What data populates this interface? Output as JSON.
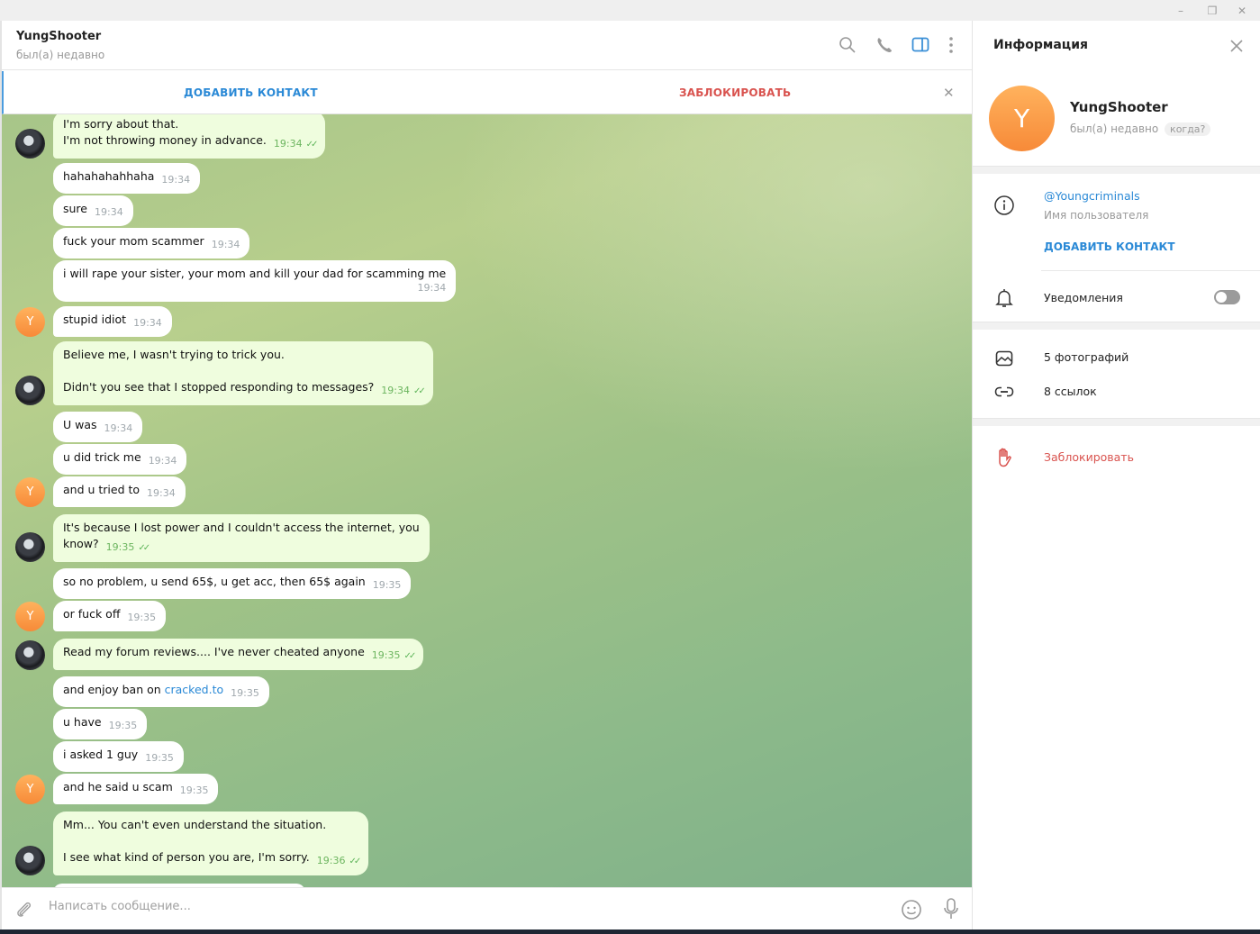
{
  "window": {
    "controls": {
      "minimize": "–",
      "restore": "❐",
      "close": "✕"
    }
  },
  "chat": {
    "title": "YungShooter",
    "status": "был(а) недавно",
    "header_icons": [
      "search-icon",
      "phone-icon",
      "sidebar-toggle-icon",
      "more-vertical-icon"
    ],
    "action_bar": {
      "add_contact": "ДОБАВИТЬ КОНТАКТ",
      "block": "ЗАБЛОКИРОВАТЬ",
      "close": "✕"
    },
    "messages": [
      {
        "dir": "out",
        "lines": [
          "I'm sorry about that.",
          "I'm not throwing money in advance."
        ],
        "time": "19:34",
        "read": true
      },
      {
        "dir": "in",
        "lines": [
          "hahahahahhaha"
        ],
        "time": "19:34"
      },
      {
        "dir": "in",
        "lines": [
          "sure"
        ],
        "time": "19:34"
      },
      {
        "dir": "in",
        "lines": [
          "fuck your mom scammer"
        ],
        "time": "19:34"
      },
      {
        "dir": "in",
        "lines": [
          "i will rape your sister, your mom and kill your dad for scamming me"
        ],
        "time": "19:34"
      },
      {
        "dir": "in",
        "lines": [
          "stupid idiot"
        ],
        "time": "19:34"
      },
      {
        "dir": "out",
        "lines": [
          "Believe me, I wasn't trying to trick you.",
          "",
          "Didn't you see that I stopped responding to messages?"
        ],
        "time": "19:34",
        "read": true
      },
      {
        "dir": "in",
        "lines": [
          "U was"
        ],
        "time": "19:34"
      },
      {
        "dir": "in",
        "lines": [
          "u did trick me"
        ],
        "time": "19:34"
      },
      {
        "dir": "in",
        "lines": [
          "and u tried to"
        ],
        "time": "19:34"
      },
      {
        "dir": "out",
        "lines": [
          "It's because I lost power and I couldn't access the internet, you",
          "know?"
        ],
        "time": "19:35",
        "read": true
      },
      {
        "dir": "in",
        "lines": [
          "so no problem, u send 65$, u get acc, then 65$ again"
        ],
        "time": "19:35"
      },
      {
        "dir": "in",
        "lines": [
          "or fuck off"
        ],
        "time": "19:35"
      },
      {
        "dir": "out",
        "lines": [
          "Read my forum reviews.... I've never cheated anyone"
        ],
        "time": "19:35",
        "read": true
      },
      {
        "dir": "in",
        "prefix": "and enjoy ban on ",
        "link": "cracked.to",
        "time": "19:35"
      },
      {
        "dir": "in",
        "lines": [
          "u have"
        ],
        "time": "19:35"
      },
      {
        "dir": "in",
        "lines": [
          "i asked 1 guy"
        ],
        "time": "19:35"
      },
      {
        "dir": "in",
        "lines": [
          "and he said u scam"
        ],
        "time": "19:35"
      },
      {
        "dir": "out",
        "lines": [
          "Mm... You can't even understand the situation.",
          "",
          "I see what kind of person you are, I'm sorry."
        ],
        "time": "19:36",
        "read": true
      }
    ],
    "composer": {
      "placeholder": "Написать сообщение..."
    },
    "avatar_letter": "Y"
  },
  "info_panel": {
    "title": "Информация",
    "name": "YungShooter",
    "avatar_letter": "Y",
    "status": "был(а) недавно",
    "when_badge": "когда?",
    "username": "@Youngcriminals",
    "username_label": "Имя пользователя",
    "add_contact": "ДОБАВИТЬ КОНТАКТ",
    "notifications_label": "Уведомления",
    "notifications_enabled": false,
    "photos": "5 фотографий",
    "links": "8 ссылок",
    "block": "Заблокировать",
    "colors": {
      "accent": "#2a89d6",
      "danger": "#d9534f",
      "avatar": "#f78a38"
    }
  }
}
